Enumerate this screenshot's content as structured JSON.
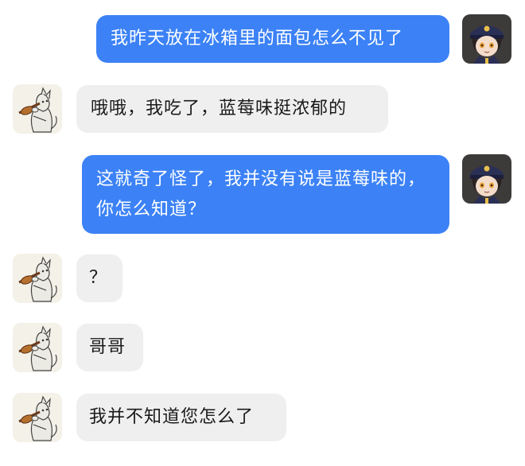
{
  "messages": [
    {
      "side": "sent",
      "text": "我昨天放在冰箱里的面包怎么不见了",
      "avatar": "boy-cap-avatar"
    },
    {
      "side": "recv",
      "text": "哦哦，我吃了，蓝莓味挺浓郁的",
      "avatar": "cat-sketch-avatar"
    },
    {
      "side": "sent",
      "text": "这就奇了怪了，我并没有说是蓝莓味的，你怎么知道？",
      "avatar": "boy-cap-avatar"
    },
    {
      "side": "recv",
      "text": "？",
      "avatar": "cat-sketch-avatar"
    },
    {
      "side": "recv",
      "text": "哥哥",
      "avatar": "cat-sketch-avatar"
    },
    {
      "side": "recv",
      "text": "我并不知道您怎么了",
      "avatar": "cat-sketch-avatar"
    }
  ],
  "colors": {
    "sent_bubble": "#3c82f6",
    "recv_bubble": "#efefef",
    "sent_text": "#ffffff",
    "recv_text": "#1a1a1a"
  }
}
